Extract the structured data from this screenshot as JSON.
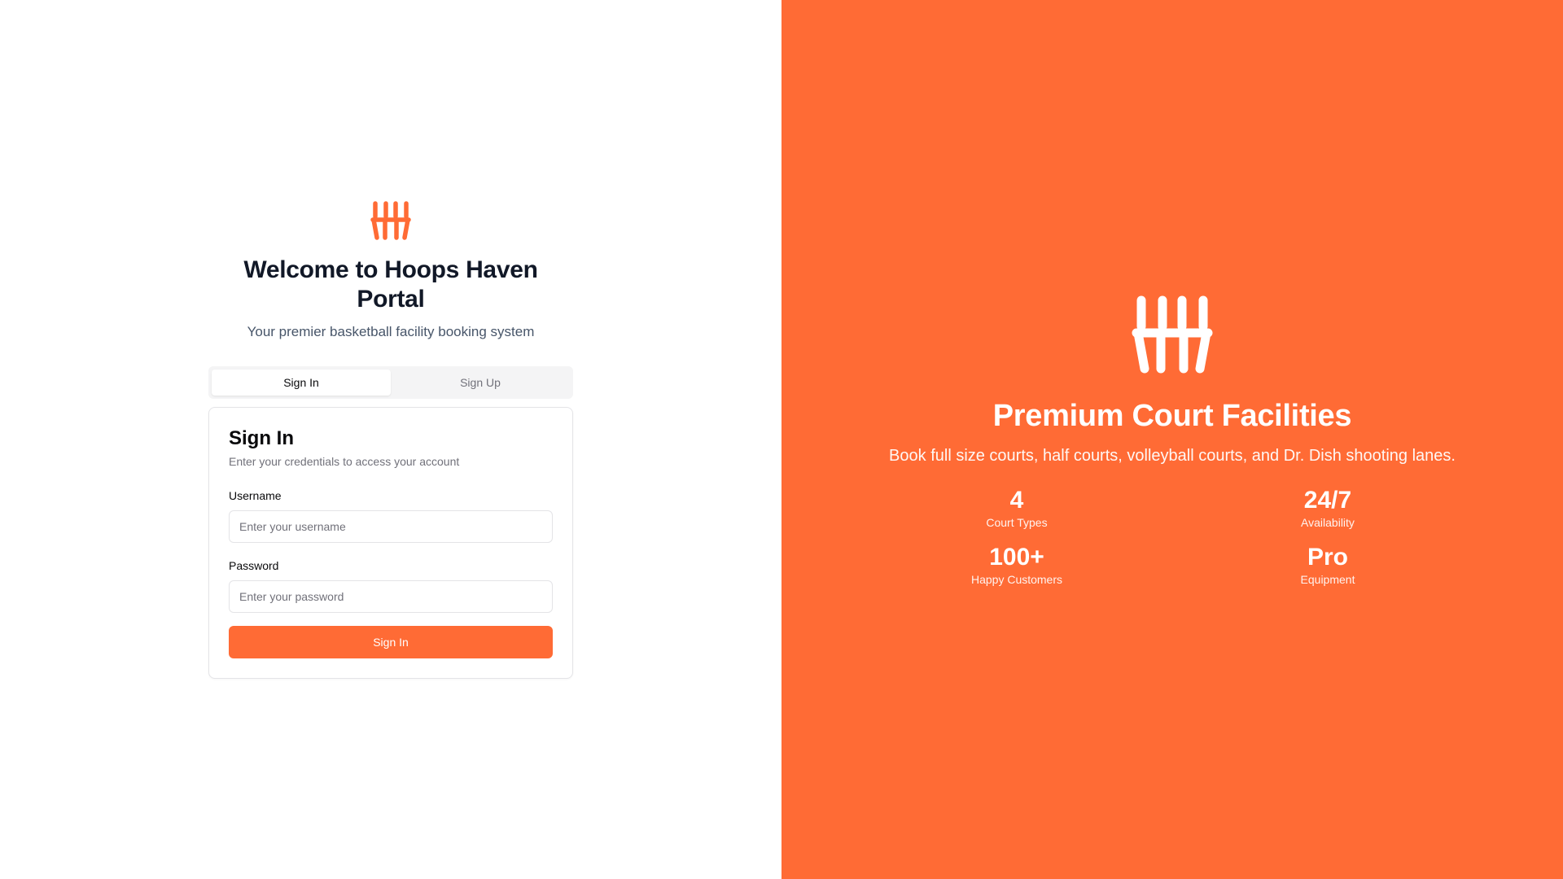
{
  "brand": {
    "accent_color": "#ff6b35",
    "logo_icon": "hoops-haven-logo-icon"
  },
  "login": {
    "title": "Welcome to Hoops Haven Portal",
    "subtitle": "Your premier basketball facility booking system",
    "tabs": [
      {
        "label": "Sign In",
        "active": true
      },
      {
        "label": "Sign Up",
        "active": false
      }
    ],
    "card": {
      "title": "Sign In",
      "description": "Enter your credentials to access your account",
      "username": {
        "label": "Username",
        "placeholder": "Enter your username",
        "value": ""
      },
      "password": {
        "label": "Password",
        "placeholder": "Enter your password",
        "value": ""
      },
      "submit_label": "Sign In"
    }
  },
  "promo": {
    "title": "Premium Court Facilities",
    "subtitle": "Book full size courts, half courts, volleyball courts, and Dr. Dish shooting lanes.",
    "stats": [
      {
        "value": "4",
        "label": "Court Types"
      },
      {
        "value": "24/7",
        "label": "Availability"
      },
      {
        "value": "100+",
        "label": "Happy Customers"
      },
      {
        "value": "Pro",
        "label": "Equipment"
      }
    ]
  }
}
